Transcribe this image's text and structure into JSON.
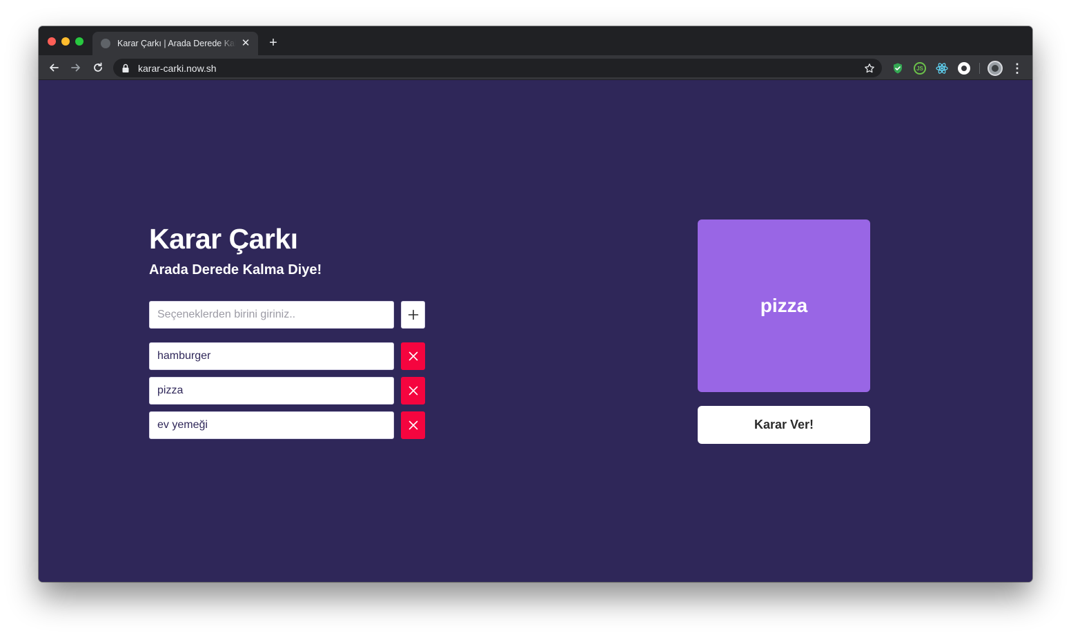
{
  "browser": {
    "tab_title": "Karar Çarkı | Arada Derede Kalma Diye!",
    "tab_close_icon": "✕",
    "new_tab_icon": "+",
    "url": "karar-carki.now.sh",
    "menu_icon": "⋮",
    "extensions": [
      {
        "name": "shield-extension-icon",
        "color": "#34a853"
      },
      {
        "name": "nodejs-extension-icon",
        "color": "#6cc24a"
      },
      {
        "name": "react-extension-icon",
        "color": "#61dafb"
      },
      {
        "name": "privacy-extension-icon",
        "color": "#ffffff"
      }
    ]
  },
  "app": {
    "title": "Karar Çarkı",
    "subtitle": "Arada Derede Kalma Diye!",
    "input": {
      "placeholder": "Seçeneklerden birini giriniz..",
      "value": ""
    },
    "options": [
      {
        "label": "hamburger"
      },
      {
        "label": "pizza"
      },
      {
        "label": "ev yemeği"
      }
    ],
    "result": "pizza",
    "decide_label": "Karar Ver!",
    "colors": {
      "background": "#2f2759",
      "result_card": "#9966e5",
      "remove_button": "#f5053f",
      "text_on_dark": "#ffffff"
    }
  }
}
